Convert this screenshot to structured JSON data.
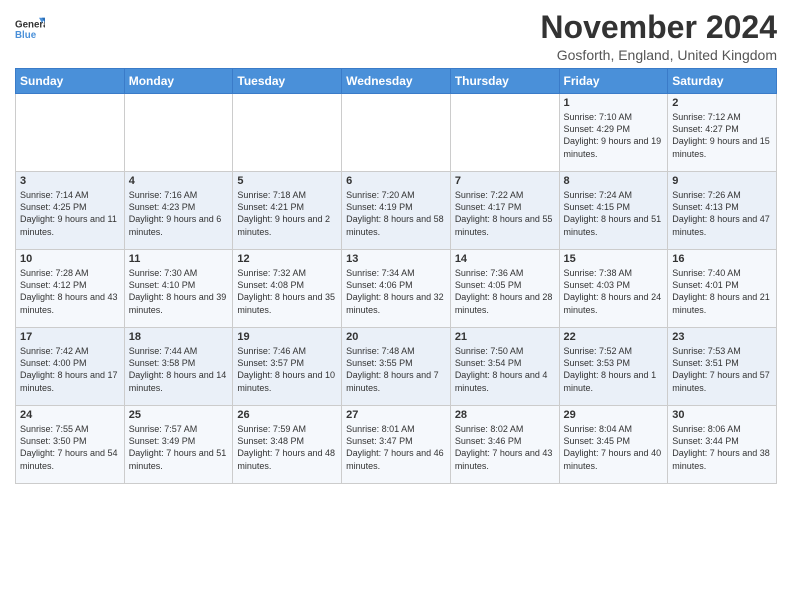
{
  "logo": {
    "text_general": "General",
    "text_blue": "Blue"
  },
  "header": {
    "month": "November 2024",
    "location": "Gosforth, England, United Kingdom"
  },
  "days_of_week": [
    "Sunday",
    "Monday",
    "Tuesday",
    "Wednesday",
    "Thursday",
    "Friday",
    "Saturday"
  ],
  "weeks": [
    [
      {
        "day": "",
        "info": ""
      },
      {
        "day": "",
        "info": ""
      },
      {
        "day": "",
        "info": ""
      },
      {
        "day": "",
        "info": ""
      },
      {
        "day": "",
        "info": ""
      },
      {
        "day": "1",
        "info": "Sunrise: 7:10 AM\nSunset: 4:29 PM\nDaylight: 9 hours and 19 minutes."
      },
      {
        "day": "2",
        "info": "Sunrise: 7:12 AM\nSunset: 4:27 PM\nDaylight: 9 hours and 15 minutes."
      }
    ],
    [
      {
        "day": "3",
        "info": "Sunrise: 7:14 AM\nSunset: 4:25 PM\nDaylight: 9 hours and 11 minutes."
      },
      {
        "day": "4",
        "info": "Sunrise: 7:16 AM\nSunset: 4:23 PM\nDaylight: 9 hours and 6 minutes."
      },
      {
        "day": "5",
        "info": "Sunrise: 7:18 AM\nSunset: 4:21 PM\nDaylight: 9 hours and 2 minutes."
      },
      {
        "day": "6",
        "info": "Sunrise: 7:20 AM\nSunset: 4:19 PM\nDaylight: 8 hours and 58 minutes."
      },
      {
        "day": "7",
        "info": "Sunrise: 7:22 AM\nSunset: 4:17 PM\nDaylight: 8 hours and 55 minutes."
      },
      {
        "day": "8",
        "info": "Sunrise: 7:24 AM\nSunset: 4:15 PM\nDaylight: 8 hours and 51 minutes."
      },
      {
        "day": "9",
        "info": "Sunrise: 7:26 AM\nSunset: 4:13 PM\nDaylight: 8 hours and 47 minutes."
      }
    ],
    [
      {
        "day": "10",
        "info": "Sunrise: 7:28 AM\nSunset: 4:12 PM\nDaylight: 8 hours and 43 minutes."
      },
      {
        "day": "11",
        "info": "Sunrise: 7:30 AM\nSunset: 4:10 PM\nDaylight: 8 hours and 39 minutes."
      },
      {
        "day": "12",
        "info": "Sunrise: 7:32 AM\nSunset: 4:08 PM\nDaylight: 8 hours and 35 minutes."
      },
      {
        "day": "13",
        "info": "Sunrise: 7:34 AM\nSunset: 4:06 PM\nDaylight: 8 hours and 32 minutes."
      },
      {
        "day": "14",
        "info": "Sunrise: 7:36 AM\nSunset: 4:05 PM\nDaylight: 8 hours and 28 minutes."
      },
      {
        "day": "15",
        "info": "Sunrise: 7:38 AM\nSunset: 4:03 PM\nDaylight: 8 hours and 24 minutes."
      },
      {
        "day": "16",
        "info": "Sunrise: 7:40 AM\nSunset: 4:01 PM\nDaylight: 8 hours and 21 minutes."
      }
    ],
    [
      {
        "day": "17",
        "info": "Sunrise: 7:42 AM\nSunset: 4:00 PM\nDaylight: 8 hours and 17 minutes."
      },
      {
        "day": "18",
        "info": "Sunrise: 7:44 AM\nSunset: 3:58 PM\nDaylight: 8 hours and 14 minutes."
      },
      {
        "day": "19",
        "info": "Sunrise: 7:46 AM\nSunset: 3:57 PM\nDaylight: 8 hours and 10 minutes."
      },
      {
        "day": "20",
        "info": "Sunrise: 7:48 AM\nSunset: 3:55 PM\nDaylight: 8 hours and 7 minutes."
      },
      {
        "day": "21",
        "info": "Sunrise: 7:50 AM\nSunset: 3:54 PM\nDaylight: 8 hours and 4 minutes."
      },
      {
        "day": "22",
        "info": "Sunrise: 7:52 AM\nSunset: 3:53 PM\nDaylight: 8 hours and 1 minute."
      },
      {
        "day": "23",
        "info": "Sunrise: 7:53 AM\nSunset: 3:51 PM\nDaylight: 7 hours and 57 minutes."
      }
    ],
    [
      {
        "day": "24",
        "info": "Sunrise: 7:55 AM\nSunset: 3:50 PM\nDaylight: 7 hours and 54 minutes."
      },
      {
        "day": "25",
        "info": "Sunrise: 7:57 AM\nSunset: 3:49 PM\nDaylight: 7 hours and 51 minutes."
      },
      {
        "day": "26",
        "info": "Sunrise: 7:59 AM\nSunset: 3:48 PM\nDaylight: 7 hours and 48 minutes."
      },
      {
        "day": "27",
        "info": "Sunrise: 8:01 AM\nSunset: 3:47 PM\nDaylight: 7 hours and 46 minutes."
      },
      {
        "day": "28",
        "info": "Sunrise: 8:02 AM\nSunset: 3:46 PM\nDaylight: 7 hours and 43 minutes."
      },
      {
        "day": "29",
        "info": "Sunrise: 8:04 AM\nSunset: 3:45 PM\nDaylight: 7 hours and 40 minutes."
      },
      {
        "day": "30",
        "info": "Sunrise: 8:06 AM\nSunset: 3:44 PM\nDaylight: 7 hours and 38 minutes."
      }
    ]
  ]
}
